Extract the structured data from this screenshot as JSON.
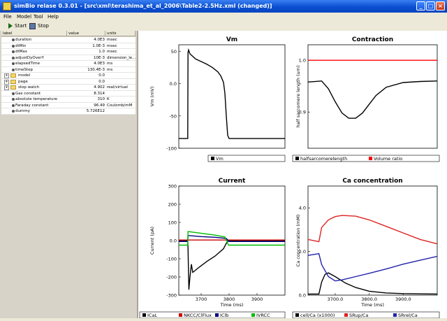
{
  "window": {
    "title": "simBio relase 0.3.01 - [src\\xml\\terashima_et_al_2006\\Table2-2.5Hz.xml (changed)]",
    "minimize": "_",
    "maximize": "□",
    "close": "×"
  },
  "menu": [
    "File",
    "Model",
    "Tool",
    "Help"
  ],
  "toolbar": {
    "start": "Start",
    "stop": "Stop"
  },
  "table": {
    "headers": [
      "label",
      "value",
      "units"
    ],
    "rows": [
      {
        "label": "duration",
        "value": "4.0E3",
        "units": "msec",
        "kind": "leaf"
      },
      {
        "label": "dtMin",
        "value": "1.0E-3",
        "units": "msec",
        "kind": "leaf"
      },
      {
        "label": "dtMax",
        "value": "1.0",
        "units": "msec",
        "kind": "leaf"
      },
      {
        "label": "adjustDyOverY",
        "value": "10E-3",
        "units": "dimension_le...",
        "kind": "leaf"
      },
      {
        "label": "elapsedTime",
        "value": "4.0E3",
        "units": "ms",
        "kind": "leaf"
      },
      {
        "label": "timeStep",
        "value": "130.4E-3",
        "units": "ms",
        "kind": "leaf"
      },
      {
        "label": "model",
        "value": "0.0",
        "units": "",
        "kind": "folder"
      },
      {
        "label": "page",
        "value": "0.0",
        "units": "",
        "kind": "folder"
      },
      {
        "label": "stop watch",
        "value": "4.902",
        "units": "real/virtual",
        "kind": "folder"
      },
      {
        "label": "Gas constant",
        "value": "8.314",
        "units": "",
        "kind": "leaf"
      },
      {
        "label": "absolute temperature",
        "value": "310",
        "units": "K",
        "kind": "leaf"
      },
      {
        "label": "Faraday constant",
        "value": "96.49",
        "units": "Coulomb/mM",
        "kind": "leaf"
      },
      {
        "label": "dummy",
        "value": "5.726E12",
        "units": "",
        "kind": "leaf"
      }
    ]
  },
  "chart_data": [
    {
      "type": "line",
      "title": "Vm",
      "xlabel": "",
      "ylabel": "Vm (mV)",
      "ylim": [
        -100,
        60
      ],
      "yticks": [
        "50",
        "0.0",
        "-50",
        "-100"
      ],
      "series": [
        {
          "name": "Vm",
          "color": "#000000",
          "x": [
            3620,
            3652,
            3653,
            3655,
            3660,
            3680,
            3700,
            3720,
            3740,
            3760,
            3770,
            3780,
            3785,
            3790,
            3795,
            3800,
            3900,
            4000
          ],
          "y": [
            -85,
            -85,
            48,
            52,
            46,
            38,
            34,
            30,
            25,
            18,
            12,
            2,
            -15,
            -50,
            -80,
            -85,
            -85,
            -85
          ]
        }
      ],
      "legend": "bottom"
    },
    {
      "type": "line",
      "title": "Contraction",
      "xlabel": "",
      "ylabel": "half sarcomere length (um)",
      "ylim": [
        0.83,
        1.03
      ],
      "yticks": [
        "1.0",
        "0.9"
      ],
      "series": [
        {
          "name": "halfsarcomerelength",
          "color": "#000000",
          "x": [
            3620,
            3660,
            3680,
            3700,
            3720,
            3740,
            3760,
            3780,
            3800,
            3820,
            3850,
            3900,
            3950,
            4000
          ],
          "y": [
            0.958,
            0.96,
            0.945,
            0.92,
            0.898,
            0.888,
            0.888,
            0.898,
            0.915,
            0.932,
            0.948,
            0.957,
            0.959,
            0.96
          ]
        },
        {
          "name": "Volume ratio",
          "color": "#ff0000",
          "x": [
            3620,
            4000
          ],
          "y": [
            1.0,
            1.0
          ]
        }
      ],
      "legend": "bottom"
    },
    {
      "type": "line",
      "title": "Current",
      "xlabel": "Time (ms)",
      "ylabel": "Current (pA)",
      "ylim": [
        -300,
        300
      ],
      "yticks": [
        "300",
        "200",
        "100",
        "0.0",
        "-100",
        "-200",
        "-300"
      ],
      "xticks": [
        "3700",
        "3800",
        "3900"
      ],
      "series": [
        {
          "name": "ICaL",
          "color": "#000000",
          "x": [
            3620,
            3652,
            3653,
            3656,
            3660,
            3665,
            3670,
            3690,
            3720,
            3750,
            3780,
            3790,
            3795,
            3800,
            4000
          ],
          "y": [
            0,
            0,
            -40,
            -270,
            -200,
            -130,
            -175,
            -150,
            -115,
            -85,
            -45,
            -15,
            -5,
            0,
            0
          ]
        },
        {
          "name": "NKCC/ClFlux",
          "color": "#cc0000",
          "x": [
            3620,
            4000
          ],
          "y": [
            3,
            3
          ]
        },
        {
          "name": "IClb",
          "color": "#000080",
          "x": [
            3620,
            3652,
            3653,
            3700,
            3750,
            3790,
            3800,
            4000
          ],
          "y": [
            -5,
            -5,
            28,
            22,
            18,
            12,
            -5,
            -5
          ]
        },
        {
          "name": "IVRCC",
          "color": "#00bb00",
          "x": [
            3620,
            3652,
            3653,
            3700,
            3750,
            3785,
            3798,
            4000
          ],
          "y": [
            -25,
            -25,
            50,
            40,
            30,
            20,
            -25,
            -25
          ]
        }
      ],
      "legend": "bottom"
    },
    {
      "type": "line",
      "title": "Ca concentration",
      "xlabel": "Time (ms)",
      "ylabel": "Ca concentration (mM)",
      "ylim": [
        0,
        5.0
      ],
      "yticks": [
        "4.0",
        "2.0",
        "0.0"
      ],
      "xticks": [
        "3700.0",
        "3800.0",
        "3900.0"
      ],
      "series": [
        {
          "name": "cell/Ca (x1000)",
          "color": "#000000",
          "x": [
            3620,
            3652,
            3660,
            3670,
            3680,
            3700,
            3730,
            3760,
            3800,
            3850,
            3900,
            4000
          ],
          "y": [
            0.05,
            0.05,
            0.6,
            0.95,
            1.02,
            0.85,
            0.55,
            0.35,
            0.18,
            0.1,
            0.07,
            0.05
          ]
        },
        {
          "name": "SRup/Ca",
          "color": "#dd2222",
          "x": [
            3620,
            3652,
            3660,
            3680,
            3700,
            3720,
            3760,
            3800,
            3850,
            3900,
            3950,
            4000
          ],
          "y": [
            2.55,
            2.45,
            3.1,
            3.45,
            3.6,
            3.65,
            3.62,
            3.45,
            3.15,
            2.85,
            2.55,
            2.35
          ]
        },
        {
          "name": "SRrel/Ca",
          "color": "#2222aa",
          "x": [
            3620,
            3652,
            3660,
            3680,
            3700,
            3720,
            3760,
            3800,
            3850,
            3900,
            3950,
            4000
          ],
          "y": [
            1.82,
            1.9,
            1.4,
            0.85,
            0.65,
            0.7,
            0.85,
            1.0,
            1.2,
            1.42,
            1.6,
            1.78
          ]
        }
      ],
      "legend": "bottom"
    }
  ]
}
